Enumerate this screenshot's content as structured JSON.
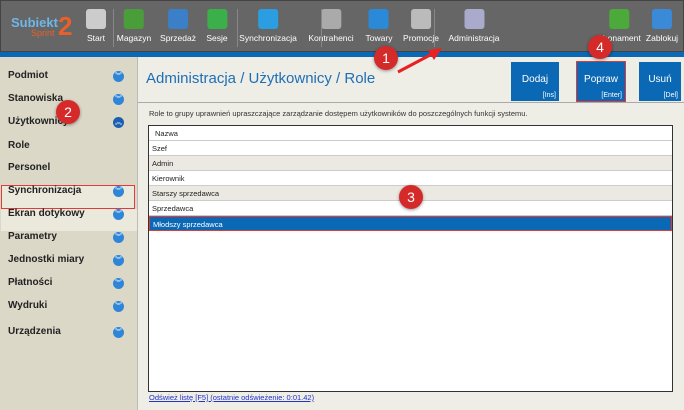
{
  "app": {
    "logo": "Subiekt",
    "logo_sub": "Sprint",
    "logo_num": "2"
  },
  "toolbar": [
    {
      "label": "Start",
      "icon": "shop-icon"
    },
    {
      "label": "Magazyn",
      "icon": "warehouse-icon"
    },
    {
      "label": "Sprzedaż",
      "icon": "sales-icon"
    },
    {
      "label": "Sesje",
      "icon": "session-icon"
    },
    {
      "label": "Synchronizacja",
      "icon": "sync-icon"
    },
    {
      "label": "Kontrahenci",
      "icon": "contractors-icon"
    },
    {
      "label": "Towary",
      "icon": "goods-icon"
    },
    {
      "label": "Promocje",
      "icon": "promo-tag-icon"
    },
    {
      "label": "Administracja",
      "icon": "tools-icon"
    },
    {
      "label": "Abonament",
      "icon": "shield-check-icon"
    },
    {
      "label": "Zablokuj",
      "icon": "lock-icon"
    }
  ],
  "sidebar": {
    "items": [
      {
        "label": "Podmiot",
        "expanded": false
      },
      {
        "label": "Stanowiska",
        "expanded": false
      },
      {
        "label": "Użytkownicy",
        "expanded": true
      },
      {
        "label": "Role",
        "sub": true,
        "selected": true
      },
      {
        "label": "Personel",
        "sub": true
      },
      {
        "label": "Synchronizacja",
        "expanded": false
      },
      {
        "label": "Ekran dotykowy",
        "expanded": false
      },
      {
        "label": "Parametry",
        "expanded": false
      },
      {
        "label": "Jednostki miary",
        "expanded": false
      },
      {
        "label": "Płatności",
        "expanded": false
      },
      {
        "label": "Wydruki",
        "expanded": false
      },
      {
        "label": "Urządzenia",
        "expanded": false
      }
    ]
  },
  "main": {
    "title": "Administracja / Użytkownicy / Role",
    "buttons": [
      {
        "label": "Dodaj",
        "key": "[Ins]"
      },
      {
        "label": "Popraw",
        "key": "[Enter]"
      },
      {
        "label": "Usuń",
        "key": "[Del]"
      }
    ],
    "description": "Role to grupy uprawnień upraszczające zarządzanie dostępem użytkowników do poszczególnych funkcji systemu.",
    "table": {
      "header": "Nazwa",
      "rows": [
        "Szef",
        "Admin",
        "Kierownik",
        "Starszy sprzedawca",
        "Sprzedawca",
        "Młodszy sprzedawca"
      ],
      "selected": "Młodszy sprzedawca"
    },
    "refresh_link": "Odśwież listę [F5] (ostatnie odświeżenie: 0:01.42)"
  },
  "annotations": [
    "1",
    "2",
    "3",
    "4"
  ],
  "colors": {
    "accent": "#0a68b4",
    "highlight": "#e03a3a",
    "toolbar": "#666666"
  }
}
